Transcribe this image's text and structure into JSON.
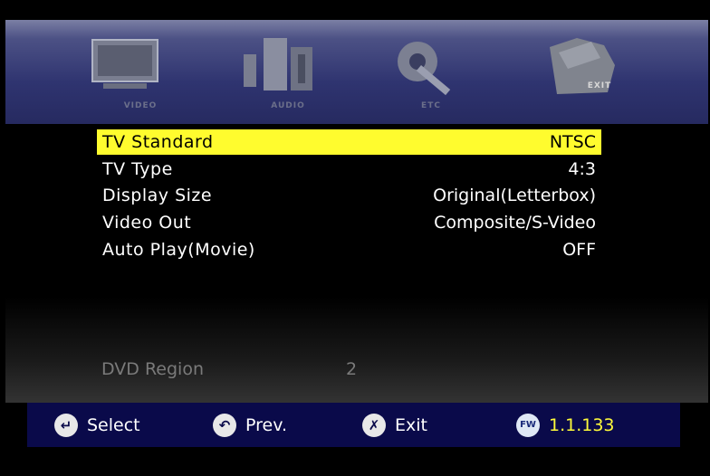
{
  "header": {
    "icons": [
      {
        "name": "video-icon",
        "label": "VIDEO"
      },
      {
        "name": "audio-icon",
        "label": "AUDIO"
      },
      {
        "name": "etc-icon",
        "label": "ETC"
      },
      {
        "name": "exit-icon",
        "label": "EXIT"
      }
    ]
  },
  "menu": {
    "items": [
      {
        "label": "TV Standard",
        "value": "NTSC",
        "selected": true
      },
      {
        "label": "TV Type",
        "value": "4:3"
      },
      {
        "label": "Display Size",
        "value": "Original(Letterbox)"
      },
      {
        "label": "Video Out",
        "value": "Composite/S-Video"
      },
      {
        "label": "Auto Play(Movie)",
        "value": "OFF"
      }
    ],
    "region": {
      "label": "DVD Region",
      "value": "2"
    }
  },
  "footer": {
    "select_label": "Select",
    "prev_label": "Prev.",
    "exit_label": "Exit",
    "fw_badge": "FW",
    "fw_version": "1.1.133"
  },
  "colors": {
    "highlight": "#fffc2e",
    "footer_bg": "#0a0a4a",
    "version_text": "#fffb3a"
  }
}
